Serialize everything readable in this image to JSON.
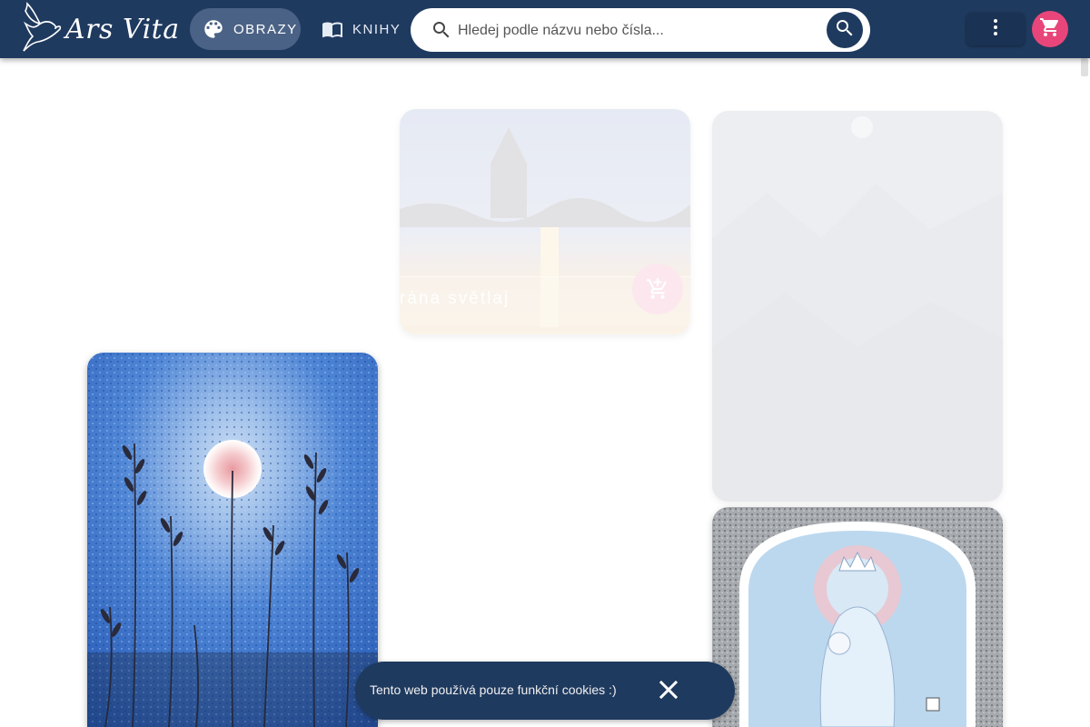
{
  "header": {
    "logo_text": "Ars Vita",
    "logo_icon": "dove-icon",
    "nav": [
      {
        "label": "OBRAZY",
        "icon": "palette-icon",
        "active": true
      },
      {
        "label": "KNIHY",
        "icon": "book-icon",
        "active": false
      }
    ],
    "search": {
      "placeholder": "Hledej podle názvu nebo čísla...",
      "value": ""
    },
    "menu_icon": "more-vert-icon",
    "cart_icon": "cart-icon"
  },
  "gallery": {
    "cards": [
      {
        "title": "rána světlaj",
        "has_cart_button": true,
        "state": "fading-in"
      },
      {
        "title": "",
        "state": "fading-in"
      },
      {
        "title": "",
        "state": "visible"
      },
      {
        "title": "",
        "state": "visible"
      }
    ]
  },
  "cookie_banner": {
    "text": "Tento web používá pouze funkční cookies :)",
    "close_icon": "close-icon"
  },
  "colors": {
    "primary": "#1f3a5f",
    "accent": "#e8467a",
    "active_nav": "#4a6285"
  }
}
